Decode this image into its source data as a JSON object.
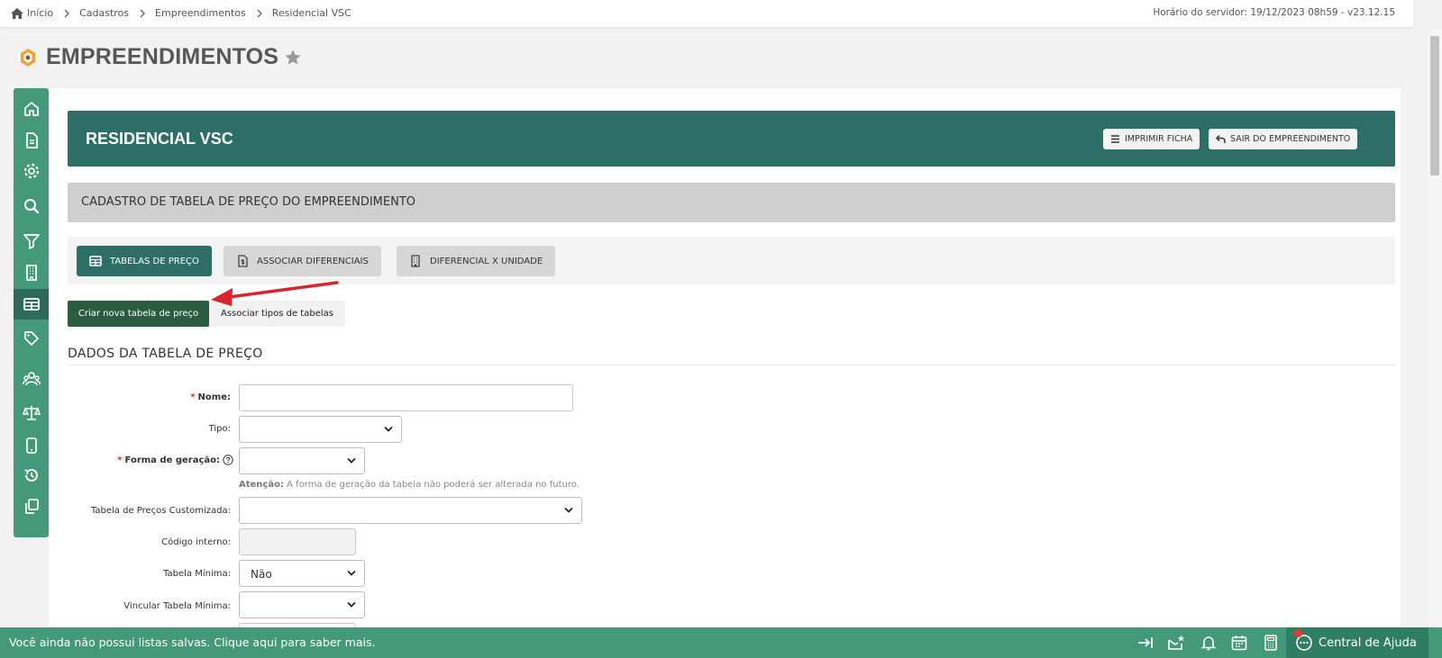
{
  "breadcrumb": [
    "Início",
    "Cadastros",
    "Empreendimentos",
    "Residencial VSC"
  ],
  "server_time": "Horário do servidor: 19/12/2023 08h59 - v23.12.15",
  "page": {
    "title": "EMPREENDIMENTOS"
  },
  "sidebar": {
    "icons": [
      "home-icon",
      "document-icon",
      "gear-icon",
      "search-icon",
      "filter-icon",
      "building-icon",
      "table-icon",
      "tag-icon",
      "users-icon",
      "scale-icon",
      "mobile-icon",
      "history-icon",
      "copy-icon"
    ],
    "active": "table-icon"
  },
  "header": {
    "title": "RESIDENCIAL VSC",
    "print_label": "IMPRIMIR FICHA",
    "exit_label": "SAIR DO EMPREENDIMENTO"
  },
  "section": {
    "title": "CADASTRO DE TABELA DE PREÇO DO EMPREENDIMENTO"
  },
  "tabs": [
    {
      "label": "TABELAS DE PREÇO",
      "active": true
    },
    {
      "label": "ASSOCIAR DIFERENCIAIS",
      "active": false
    },
    {
      "label": "DIFERENCIAL X UNIDADE",
      "active": false
    }
  ],
  "actions": {
    "create_label": "Criar nova tabela de preço",
    "associate_label": "Associar tipos de tabelas"
  },
  "form": {
    "title": "DADOS DA TABELA DE PREÇO",
    "required_mark": "*",
    "fields": {
      "nome": {
        "label": "Nome:",
        "value": ""
      },
      "tipo": {
        "label": "Tipo:",
        "value": ""
      },
      "forma": {
        "label": "Forma de geração:",
        "value": ""
      },
      "customizada": {
        "label": "Tabela de Preços Customizada:",
        "value": ""
      },
      "codigo": {
        "label": "Código interno:",
        "value": ""
      },
      "minima": {
        "label": "Tabela Mínima:",
        "value": "Não"
      },
      "vincular": {
        "label": "Vincular Tabela Mínima:",
        "value": ""
      }
    },
    "note_strong": "Atenção:",
    "note_text": " A forma de geração da tabela não poderá ser alterada no futuro."
  },
  "bottom_bar": {
    "message": "Você ainda não possui listas salvas. Clique aqui para saber mais.",
    "help_label": "Central de Ajuda"
  },
  "colors": {
    "sidebar": "#43997a",
    "header": "#2d6e66",
    "primary_button": "#2a5c40",
    "arrow": "#d9232d"
  }
}
